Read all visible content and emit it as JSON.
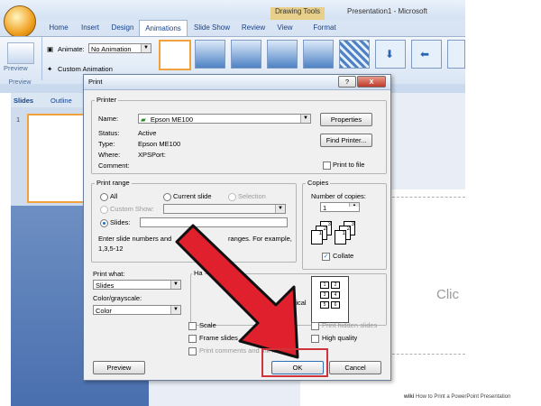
{
  "titlebar": {
    "context_tab": "Drawing Tools",
    "title_fragment": "Presentation1 - Microsoft"
  },
  "ribbon": {
    "tabs": [
      "Home",
      "Insert",
      "Design",
      "Animations",
      "Slide Show",
      "Review",
      "View",
      "Format"
    ],
    "active_tab": "Animations",
    "preview_label": "Preview",
    "preview_group": "Preview",
    "animate_label": "Animate:",
    "animate_value": "No Animation",
    "custom_animation": "Custom Animation"
  },
  "slides_pane": {
    "tabs": [
      "Slides",
      "Outline"
    ],
    "slide_number": "1"
  },
  "slide": {
    "placeholder_text": "Clic"
  },
  "dialog": {
    "title": "Print",
    "help_button": "?",
    "close_button": "X",
    "printer": {
      "group_label": "Printer",
      "name_label": "Name:",
      "name_value": "Epson ME100",
      "status_label": "Status:",
      "status_value": "Active",
      "type_label": "Type:",
      "type_value": "Epson ME100",
      "where_label": "Where:",
      "where_value": "XPSPort:",
      "comment_label": "Comment:",
      "properties_button": "Properties",
      "find_printer_button": "Find Printer...",
      "print_to_file": "Print to file"
    },
    "print_range": {
      "group_label": "Print range",
      "all": "All",
      "current_slide": "Current slide",
      "selection": "Selection",
      "custom_show": "Custom Show:",
      "slides": "Slides:",
      "hint_line1": "Enter slide numbers and/or slide ranges. For example,",
      "hint_line2": "1,3,5-12",
      "hint_visible_left": "Enter slide numbers and",
      "hint_visible_right": "ranges. For example,"
    },
    "copies": {
      "group_label": "Copies",
      "number_label": "Number of copies:",
      "number_value": "1",
      "collate": "Collate"
    },
    "print_what": {
      "label": "Print what:",
      "value": "Slides"
    },
    "color": {
      "label": "Color/grayscale:",
      "value": "Color"
    },
    "handouts": {
      "label_fragment": "Ha",
      "vertical": "Vertical",
      "grid": [
        "1",
        "2",
        "3",
        "4",
        "5",
        "6"
      ]
    },
    "options": {
      "scale": "Scale",
      "frame_slides": "Frame slides",
      "print_comments": "Print comments and ink markup",
      "print_hidden": "Print hidden slides",
      "high_quality": "High quality"
    },
    "buttons": {
      "preview": "Preview",
      "ok": "OK",
      "cancel": "Cancel"
    }
  },
  "caption": {
    "brand": "wiki",
    "text": "How to Print a PowerPoint Presentation"
  },
  "colors": {
    "arrow": "#e0202c",
    "arrow_outline": "#111111",
    "highlight": "#d1333d",
    "ribbon": "#c9d9ee",
    "accent": "#f2a23c"
  }
}
